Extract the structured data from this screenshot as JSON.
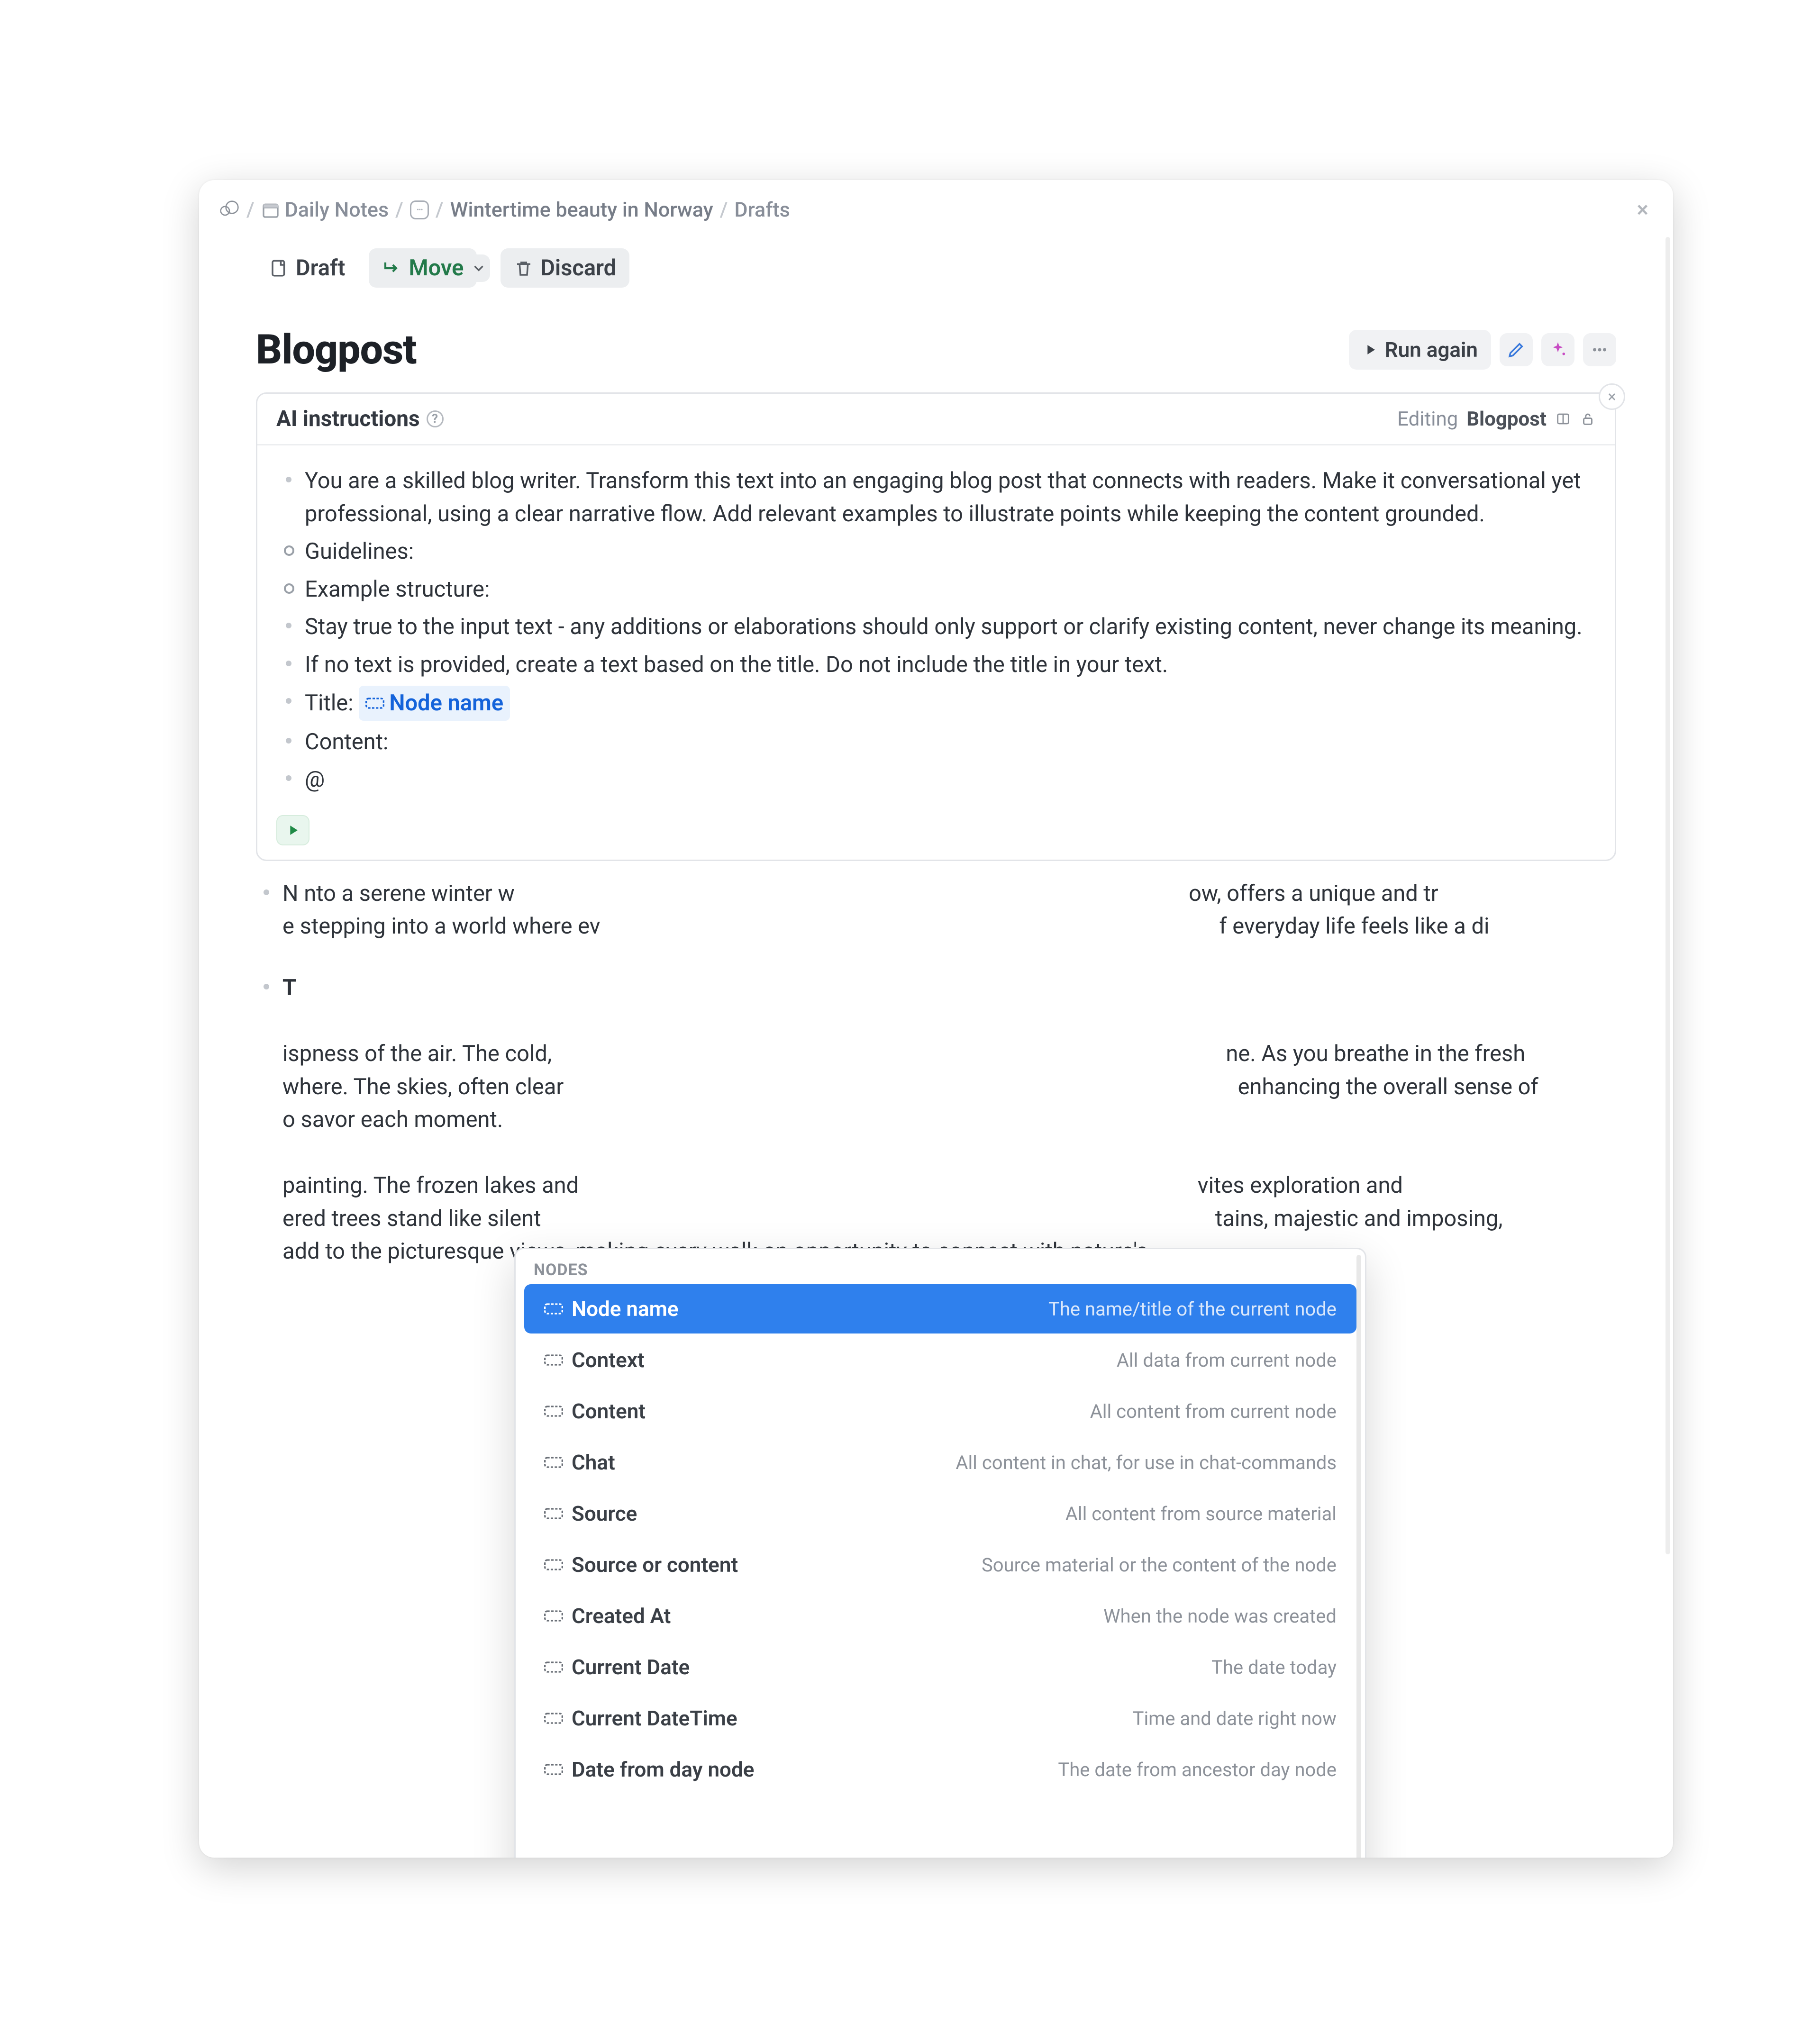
{
  "breadcrumb": {
    "daily_notes": "Daily Notes",
    "page": "Wintertime beauty in Norway",
    "last": "Drafts"
  },
  "toolbar": {
    "draft": "Draft",
    "move": "Move",
    "discard": "Discard"
  },
  "page_title": "Blogpost",
  "title_actions": {
    "run_again": "Run again"
  },
  "ai_box": {
    "header_left": "AI instructions",
    "header_right_prefix": "Editing",
    "header_right_strong": "Blogpost",
    "bullets": [
      "You are a skilled blog writer. Transform this text into an engaging blog post that connects with readers. Make it conversational yet professional, using a clear narrative flow. Add relevant examples to illustrate points while keeping the content grounded.",
      "Guidelines:",
      "Example structure:",
      "Stay true to the input text - any additions or elaborations should only support or clarify existing content, never change its meaning.",
      "If no text is provided, create a text based on the title. Do not include the title in your text."
    ],
    "title_label": "Title:",
    "title_ref": "Node name",
    "content_label": "Content:",
    "at": "@"
  },
  "content_below": {
    "p1_prefix": "N",
    "p1_rest": "nto a serene winter w                                                                                                                          ow, offers a unique and tr                                                                                                                          e stepping into a world where ev                                                                                                                f everyday life feels like a di",
    "p2_strong": "T",
    "p2_rest_a": "ispness of the air. The cold,                                                                                                                          ne. As you breathe in the fresh                                                                                                                where. The skies, often clear                                                                                                                          enhancing the overall sense of                                                                                                                o savor each moment.",
    "p2_rest_b": "painting. The frozen lakes and                                                                                                                vites exploration and                                                                                                                          ered trees stand like silent                                                                                                                          tains, majestic and imposing,",
    "p2_last": "add to the picturesque views, making every walk an opportunity to connect with nature's"
  },
  "dropdown": {
    "heading": "NODES",
    "items": [
      {
        "label": "Node name",
        "desc": "The name/title of the current node"
      },
      {
        "label": "Context",
        "desc": "All data from current node"
      },
      {
        "label": "Content",
        "desc": "All content from current node"
      },
      {
        "label": "Chat",
        "desc": "All content in chat, for use in chat-commands"
      },
      {
        "label": "Source",
        "desc": "All content from source material"
      },
      {
        "label": "Source or content",
        "desc": "Source material or the content of the node"
      },
      {
        "label": "Created At",
        "desc": "When the node was created"
      },
      {
        "label": "Current Date",
        "desc": "The date today"
      },
      {
        "label": "Current DateTime",
        "desc": "Time and date right now"
      },
      {
        "label": "Date from day node",
        "desc": "The date from ancestor day node"
      }
    ]
  }
}
